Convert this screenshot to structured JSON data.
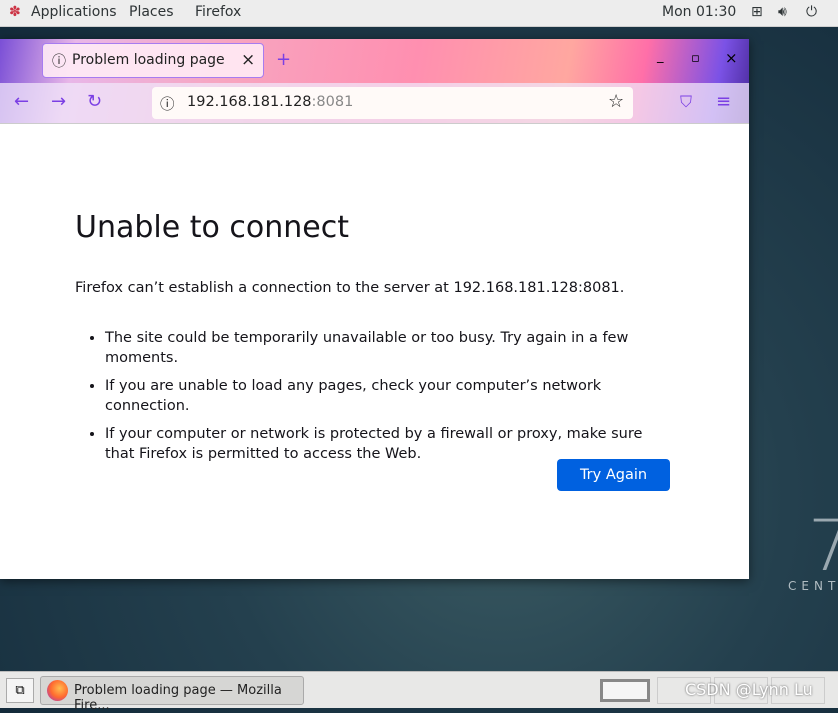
{
  "topbar": {
    "applications": "Applications",
    "places": "Places",
    "firefox": "Firefox",
    "clock": "Mon 01:30"
  },
  "tab": {
    "title": "Problem loading page",
    "close": "×",
    "new_tab": "+"
  },
  "window_controls": {
    "minimize": "_",
    "maximize": "▫",
    "close": "×"
  },
  "nav": {
    "url_host": "192.168.181.128",
    "url_port": ":8081"
  },
  "page": {
    "title": "Unable to connect",
    "description": "Firefox can’t establish a connection to the server at 192.168.181.128:8081.",
    "bullets": [
      "The site could be temporarily unavailable or too busy. Try again in a few moments.",
      "If you are unable to load any pages, check your computer’s network connection.",
      "If your computer or network is protected by a firewall or proxy, make sure that Firefox is permitted to access the Web."
    ],
    "try_again": "Try Again"
  },
  "desktop": {
    "logo_text": "CENT"
  },
  "taskbar": {
    "task_label": "Problem loading page — Mozilla Fire...",
    "watermark": "CSDN @Lynn Lu"
  }
}
